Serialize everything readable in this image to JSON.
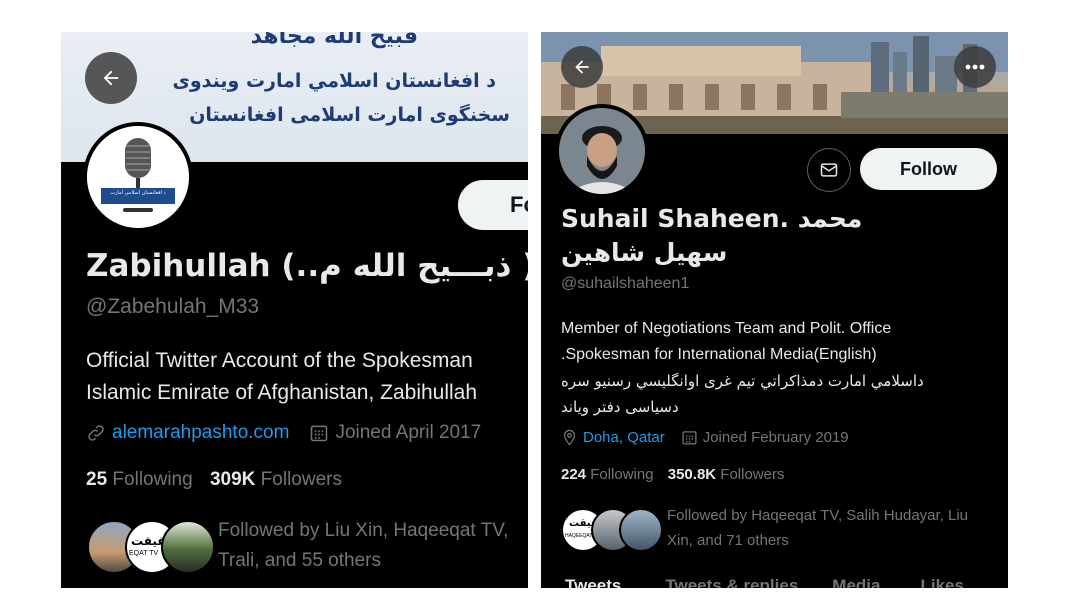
{
  "left": {
    "banner": {
      "line_top": "قبيح الله مجاهد",
      "line1": "د افغانستان اسلامي امارت ويندوى",
      "line2": "سخنگوى امارت اسلامى افغانستان"
    },
    "follow_label": "Fo",
    "name": "Zabihullah (..ذبـــيح الله م )",
    "handle": "@Zabehulah_M33",
    "bio_line1": "Official Twitter Account of the Spokesman",
    "bio_line2": "Islamic Emirate of Afghanistan, Zabihullah",
    "website": "alemarahpashto.com",
    "joined": "Joined April 2017",
    "following_count": "25",
    "following_label": "Following",
    "followers_count": "309K",
    "followers_label": "Followers",
    "followed_line1": "Followed by Liu Xin, Haqeeqat TV,",
    "followed_line2": "Trali, and 55 others",
    "avatar_caption": "د افغانستان اسلامي امارت",
    "haqeeqat_logo": "حقيقت",
    "haqeeqat_sub": "EQAT TV"
  },
  "right": {
    "follow_label": "Follow",
    "name_line1": "Suhail Shaheen. محمد",
    "name_line2": "سهيل شاهين",
    "handle": "@suhailshaheen1",
    "bio_line1": "Member of Negotiations Team and Polit. Office",
    "bio_line2": ".Spokesman for International Media(English)",
    "bio_line3": "داسلامي امارت دمذاكراتي تيم غرى اوانگليسي رسنيو سره",
    "bio_line4": "دسياسى دفتر وياند",
    "location": "Doha, Qatar",
    "joined": "Joined February 2019",
    "following_count": "224",
    "following_label": "Following",
    "followers_count": "350.8K",
    "followers_label": "Followers",
    "followed_line1": "Followed by Haqeeqat TV, Salih Hudayar, Liu",
    "followed_line2": "Xin, and 71 others",
    "haqeeqat_logo": "حقيقت",
    "haqeeqat_sub": "HAQEEQAT TV",
    "tabs": [
      "Tweets",
      "Tweets & replies",
      "Media",
      "Likes"
    ]
  },
  "icons": {
    "back": "arrow-left-icon",
    "more": "more-horizontal-icon",
    "mail": "envelope-icon",
    "link": "link-icon",
    "calendar": "calendar-icon",
    "location": "location-pin-icon"
  },
  "colors": {
    "link": "#1d9bf0",
    "muted": "#71767b",
    "background": "#000000"
  }
}
